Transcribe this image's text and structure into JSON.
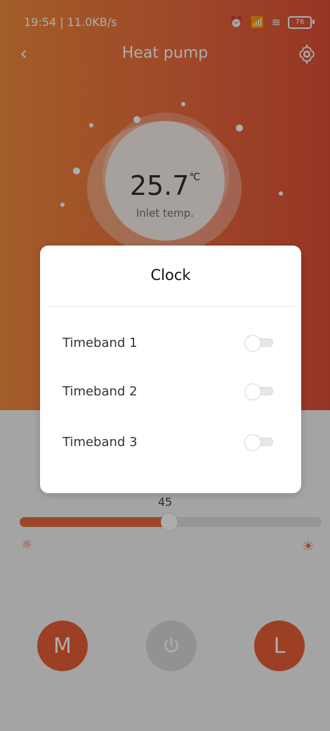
{
  "status_bar": {
    "time_speed": "19:54 | 11.0KB/s",
    "battery": "76"
  },
  "app": {
    "title": "Heat pump",
    "inlet_temperature": "25.7",
    "temperature_unit": "℃",
    "inlet_label": "Inlet temp."
  },
  "slider": {
    "value_label": "45"
  },
  "modes": {
    "m_label": "M",
    "l_label": "L"
  },
  "modal": {
    "title": "Clock",
    "rows": [
      {
        "label": "Timeband 1",
        "on": false
      },
      {
        "label": "Timeband 2",
        "on": false
      },
      {
        "label": "Timeband 3",
        "on": false
      }
    ]
  }
}
